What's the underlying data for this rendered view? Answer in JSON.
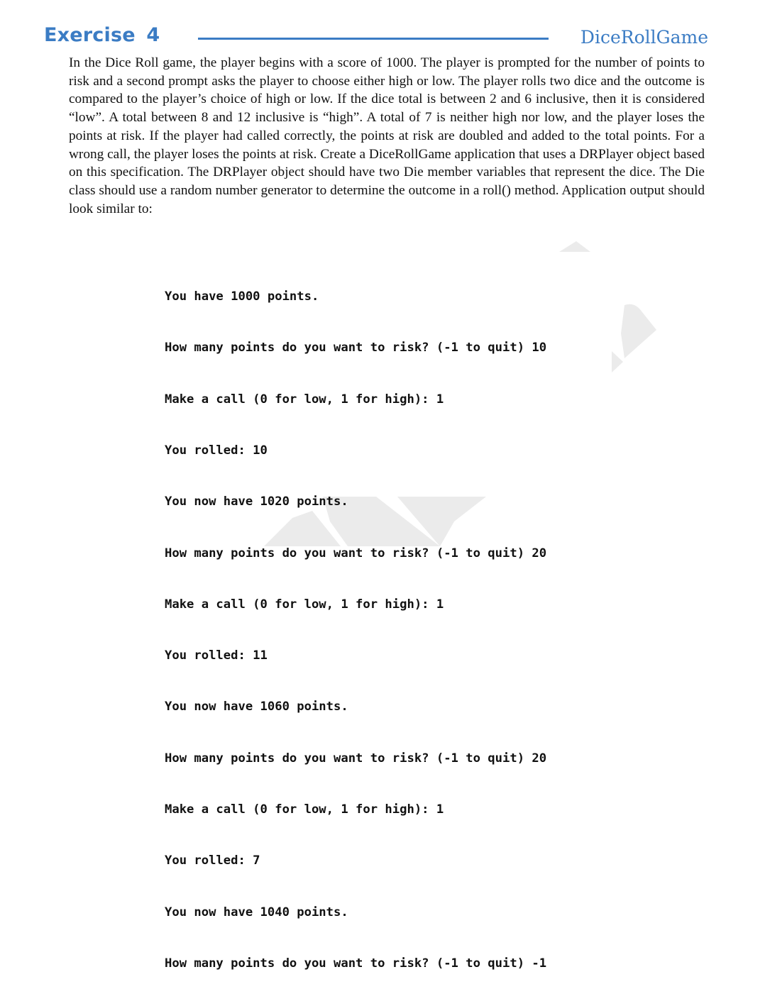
{
  "header": {
    "exercise_label": "Exercise 4",
    "project_name": "DiceRollGame",
    "accent_color": "#3b7cc4"
  },
  "description": {
    "text": "In the Dice Roll game, the player begins with a score of 1000. The player is prompted for the number of points to risk and a second prompt asks the player to choose either high or low. The player rolls two dice and the outcome is compared to the player’s choice of high or low. If the dice total is between 2 and 6 inclusive, then it is considered “low”. A total between 8 and 12 inclusive is “high”. A total of 7 is neither high nor low, and the player loses the points at risk. If the player had called correctly, the points at risk are doubled and added to the total points. For a wrong call, the player loses the points at risk. Create a DiceRollGame application that uses a DRPlayer object based on this specification. The DRPlayer object should have two Die member variables that represent the dice. The Die class should use a random number generator to determine the outcome in a roll() method. Application output should look similar to:"
  },
  "console_output": {
    "lines": [
      "You have 1000 points.",
      "How many points do you want to risk? (-1 to quit) 10",
      "Make a call (0 for low, 1 for high): 1",
      "You rolled: 10",
      "You now have 1020 points.",
      "How many points do you want to risk? (-1 to quit) 20",
      "Make a call (0 for low, 1 for high): 1",
      "You rolled: 11",
      "You now have 1060 points.",
      "How many points do you want to risk? (-1 to quit) 20",
      "Make a call (0 for low, 1 for high): 1",
      "You rolled: 7",
      "You now have 1040 points.",
      "How many points do you want to risk? (-1 to quit) -1"
    ]
  }
}
